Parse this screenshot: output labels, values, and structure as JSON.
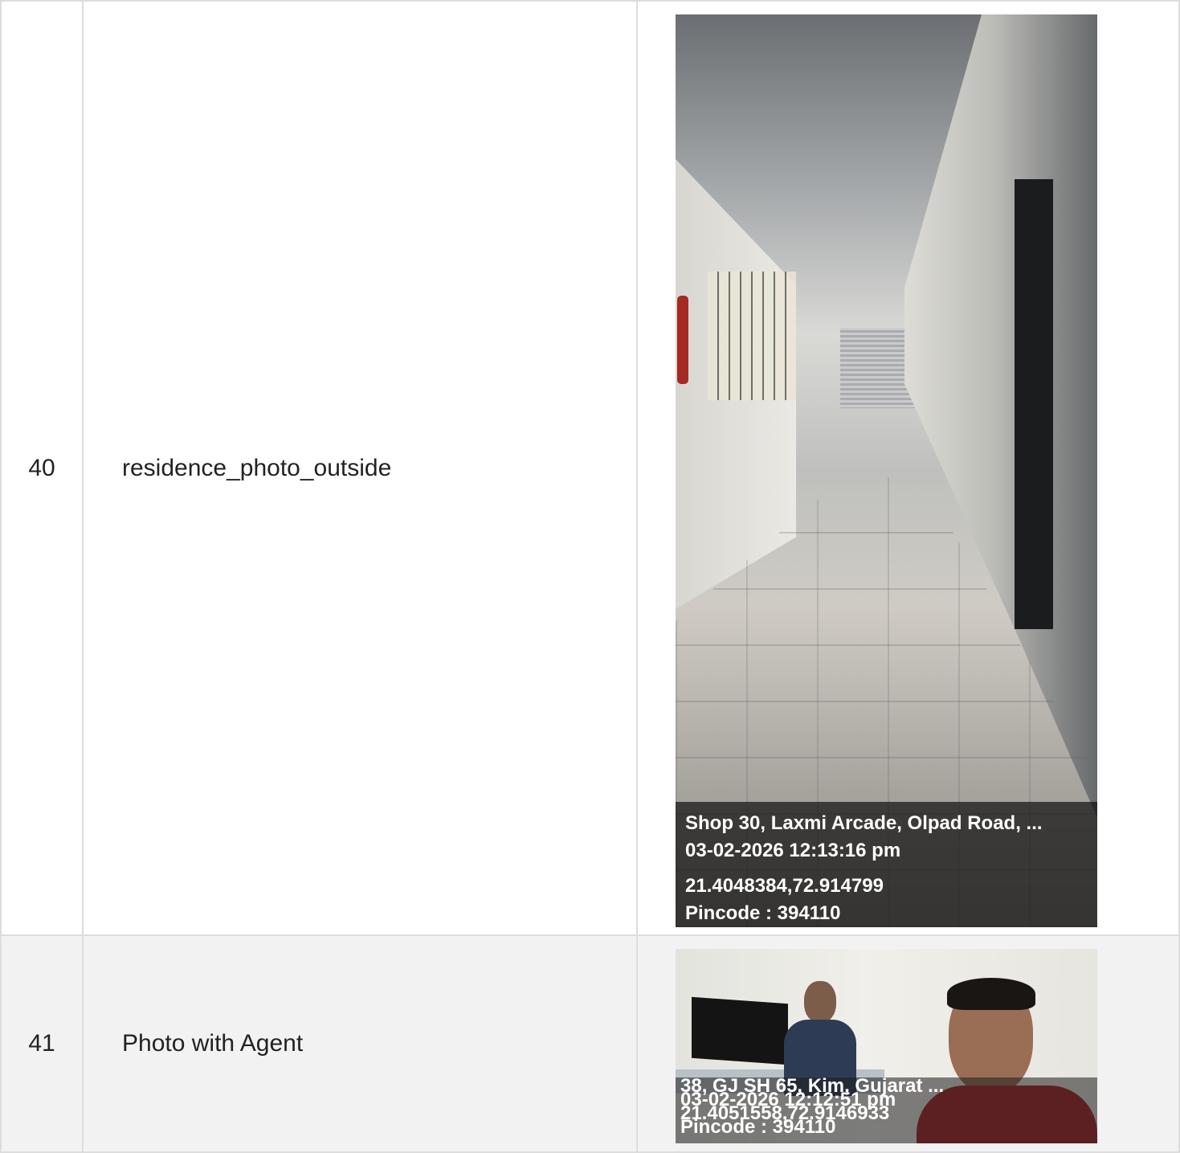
{
  "rows": [
    {
      "number": "40",
      "label": "residence_photo_outside",
      "photo": {
        "stamp": {
          "address": "Shop 30, Laxmi Arcade, Olpad Road, ...",
          "datetime": "03-02-2026 12:13:16 pm",
          "coords": "21.4048384,72.914799",
          "pincode": "Pincode : 394110"
        }
      }
    },
    {
      "number": "41",
      "label": "Photo with Agent",
      "photo": {
        "stamp": {
          "address": "38, GJ SH 65, Kim, Gujarat ...",
          "datetime": "03-02-2026 12:12:51 pm",
          "coords": "21.4051558,72.9146933",
          "pincode": "Pincode : 394110"
        }
      }
    }
  ]
}
